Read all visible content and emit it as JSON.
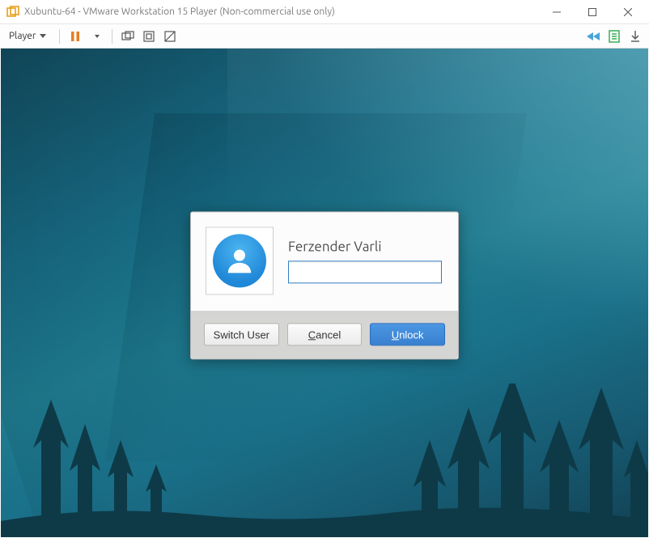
{
  "window": {
    "title": "Xubuntu-64 - VMware Workstation 15 Player (Non-commercial use only)"
  },
  "toolbar": {
    "player_label": "Player"
  },
  "lock": {
    "user_name": "Ferzender Varli",
    "password_value": "",
    "switch_user_label": "Switch User",
    "cancel_label_pref": "C",
    "cancel_label_ul": "ancel",
    "unlock_label_ul": "U",
    "unlock_label_suf": "nlock"
  }
}
